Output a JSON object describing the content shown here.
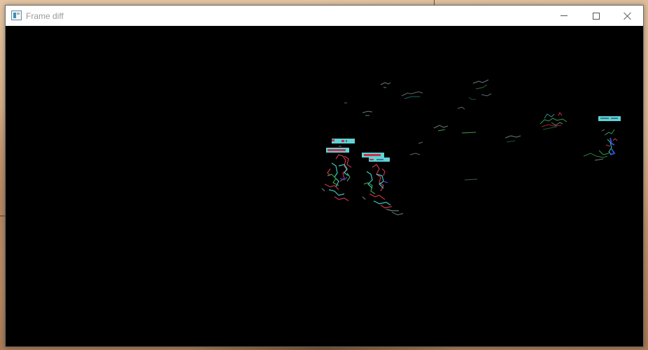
{
  "window": {
    "title": "Frame diff",
    "icon": "app-window-icon",
    "controls": {
      "minimize_icon": "minimize-icon",
      "maximize_icon": "maximize-icon",
      "close_icon": "close-icon"
    }
  },
  "canvas": {
    "background": "#000000",
    "description_colors": {
      "label_bar": "#5fd3d6",
      "label_text": "#d04a5a",
      "artifact_red": "#c8324a",
      "artifact_cyan": "#3fc8c0",
      "artifact_green": "#3a9a4a",
      "artifact_gray": "#6a7a7a",
      "artifact_blue": "#3050c8"
    }
  }
}
